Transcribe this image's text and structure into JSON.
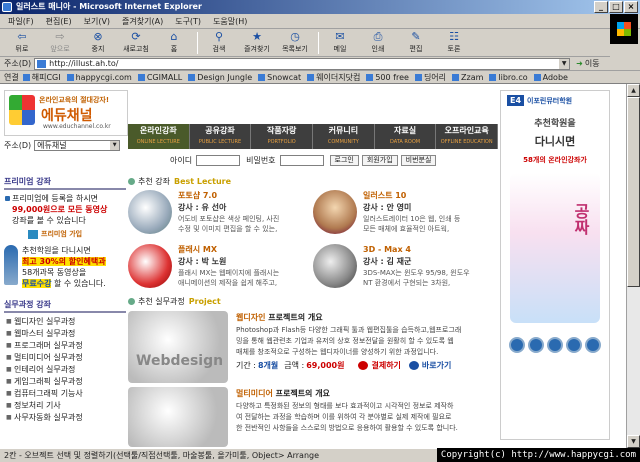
{
  "window": {
    "title": "일러스트 매니아 - Microsoft Internet Explorer"
  },
  "menu": [
    "파일(F)",
    "편집(E)",
    "보기(V)",
    "즐겨찾기(A)",
    "도구(T)",
    "도움말(H)"
  ],
  "toolbar": [
    {
      "label": "뒤로",
      "icon": "back-arrow-icon",
      "glyph": "⇦",
      "disabled": false
    },
    {
      "label": "앞으로",
      "icon": "forward-arrow-icon",
      "glyph": "⇨",
      "disabled": true
    },
    {
      "label": "중지",
      "icon": "stop-icon",
      "glyph": "⊗",
      "disabled": false
    },
    {
      "label": "새로고침",
      "icon": "refresh-icon",
      "glyph": "⟳",
      "disabled": false
    },
    {
      "label": "홈",
      "icon": "home-icon",
      "glyph": "⌂",
      "disabled": false
    },
    {
      "label": "검색",
      "icon": "search-icon",
      "glyph": "⚲",
      "disabled": false
    },
    {
      "label": "즐겨찾기",
      "icon": "favorites-icon",
      "glyph": "★",
      "disabled": false
    },
    {
      "label": "목록보기",
      "icon": "history-icon",
      "glyph": "◷",
      "disabled": false
    },
    {
      "label": "메일",
      "icon": "mail-icon",
      "glyph": "✉",
      "disabled": false
    },
    {
      "label": "인쇄",
      "icon": "print-icon",
      "glyph": "⎙",
      "disabled": false
    },
    {
      "label": "편집",
      "icon": "edit-icon",
      "glyph": "✎",
      "disabled": false
    },
    {
      "label": "토론",
      "icon": "discuss-icon",
      "glyph": "☷",
      "disabled": false
    }
  ],
  "address": {
    "label": "주소(D)",
    "url": "http://illust.ah.to/",
    "go": "이동"
  },
  "links": {
    "label": "연결",
    "items": [
      "해피CGI",
      "happycgi.com",
      "CGIMALL",
      "Design Jungle",
      "Snowcat",
      "웨이더지닷컴",
      "500 free",
      "딩어리",
      "Zzam",
      "libro.co",
      "Adobe"
    ]
  },
  "site": {
    "slogan": "온라인교육의 절대강자!",
    "name": "에듀채널",
    "url": "www.educhannel.co.kr",
    "address_label": "주소(D)",
    "address_value": "에듀채널"
  },
  "nav": [
    {
      "ko": "온라인강좌",
      "en": "ONLINE LECTURE"
    },
    {
      "ko": "공유강좌",
      "en": "PUBLIC LECTURE"
    },
    {
      "ko": "작품자랑",
      "en": "PORTFOLIO"
    },
    {
      "ko": "커뮤니티",
      "en": "COMMUNITY"
    },
    {
      "ko": "자료실",
      "en": "DATA ROOM"
    },
    {
      "ko": "오프라인교육",
      "en": "OFFLINE EDUCATION"
    }
  ],
  "login": {
    "id_label": "아이디",
    "pw_label": "비밀번호",
    "login": "로그인",
    "join": "회원가입",
    "find": "비번분실"
  },
  "left": {
    "free_header": "프리미엄 강좌",
    "free_text1": "프리미엄에 등록을 하시면",
    "free_text2": "99,000원으로 모든 동영상",
    "free_text3": "강좌를 볼 수 있습니다",
    "join_premium": "프리미엄 가입",
    "promo1": "추천학원을 다니시면",
    "promo2": "최고 30%의 할인혜택과",
    "promo3": "58개과목 동영상을",
    "promo4": "무료수강",
    "promo5": "할 수 있습니다.",
    "practice_header": "실무과정 강좌",
    "practice": [
      "웹디자인 실무과정",
      "웹마스터 실무과정",
      "프로그래머 실무과정",
      "멀티미디어 실무과정",
      "인테리어 실무과정",
      "게임그래픽 실무과정",
      "컴퓨터그래픽 기능사",
      "정보처리 기사",
      "사무자동화 실무과정"
    ]
  },
  "best": {
    "ko": "추천 강좌",
    "en": "Best Lecture"
  },
  "lectures": [
    {
      "title": "포토샵 7.0",
      "teacher": "강사 : 유 선아",
      "desc1": "어도비 포토샵은 색상 페인팅, 사진",
      "desc2": "수정 및 이미지 편집을 할 수 있는,"
    },
    {
      "title": "일러스트 10",
      "teacher": "강사 : 안 영미",
      "desc1": "일러스트레이터 10은 웹, 인쇄 등",
      "desc2": "모든 매체에 효율적인 아트웍,"
    },
    {
      "title": "플래시 MX",
      "teacher": "강사 : 박 노원",
      "desc1": "플래시 MX는 웹페이지에 플래시는",
      "desc2": "애니메이션의 제작을 쉽게 해주고,"
    },
    {
      "title": "3D - Max 4",
      "teacher": "강사 : 김 재군",
      "desc1": "3DS-MAX는 윈도우 95/98, 윈도우",
      "desc2": "NT 환경에서 구현되는 3차원,"
    }
  ],
  "project": {
    "ko": "추천 실무과정",
    "en": "Project"
  },
  "projects": [
    {
      "title_or": "웹디자인",
      "title": "프로젝트의 개요",
      "img": "Webdesign",
      "desc": [
        "Photoshop과 Flash등 다양한 그래픽 툴과 웹편집툴을 습득하고,웹프로그래",
        "밍을 통해 웹관련초 기업과 유저의 상호 정보전달을 원활히 할 수 있도록 웹",
        "매체를 창조적으로 구성하는 웹디자이너를 양성하기 위한 과정입니다."
      ],
      "period_label": "기간 :",
      "period": "8개월",
      "price_label": "금액 :",
      "price": "69,000원",
      "apply": "결제하기",
      "go": "바로가기"
    },
    {
      "title_or": "멀티미디어",
      "title": "프로젝트의 개요",
      "desc": [
        "다양하고 특정화된 정보의 형태를 보다 효과적이고 시각적인 정보로 제작하",
        "여 전달하는 과정을 학습하며 이를 위하여 각 분야별로 실제 제작에 필요로",
        "한 전반적인 사항들을 스스로의 방법으로 응용하여 활용할 수 있도록 합니다."
      ]
    }
  ],
  "ad": {
    "e4": "E4",
    "school": "이포린뮤터학원",
    "h1": "추천학원을",
    "h2": "다니시면",
    "h3": "58개의 온라인강좌가",
    "free": "공짜"
  },
  "status": "2칸 - 오브젝트 선택 및 정렬하기(선택툴/직접선택툴, 마술봉툴, 올가미툴, Object> Arrange",
  "copyright": "Copyright(c) http://www.happycgi.com"
}
